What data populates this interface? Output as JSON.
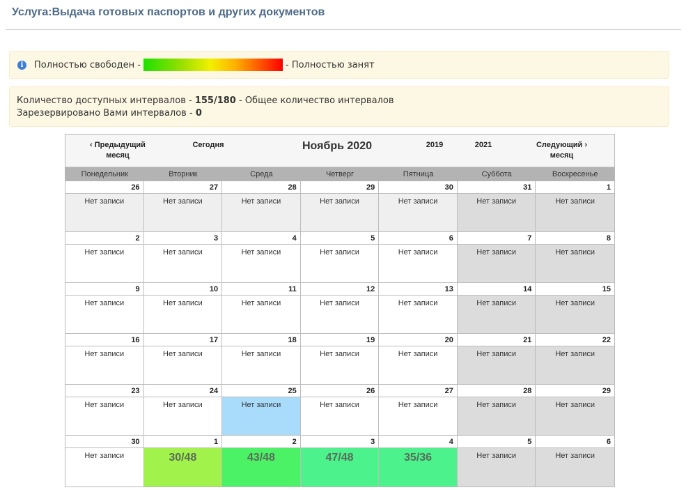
{
  "title": "Услуга:Выдача готовых паспортов и других документов",
  "legend": {
    "free_label": "Полностью свободен -",
    "busy_label": "- Полностью занят",
    "info_icon": "info-icon"
  },
  "stats": {
    "line1_prefix": "Количество доступных интервалов -",
    "line1_value": "155/180",
    "line1_suffix": "- Общее количество интервалов",
    "line2_prefix": "Зарезервировано Вами интервалов -",
    "line2_value": "0"
  },
  "calendar": {
    "prev_month": "‹ Предыдущий месяц",
    "today": "Сегодня",
    "month_title": "Ноябрь 2020",
    "prev_year": "2019",
    "next_year": "2021",
    "next_month": "Следующий › месяц",
    "weekdays": [
      "Понедельник",
      "Вторник",
      "Среда",
      "Четверг",
      "Пятница",
      "Суббота",
      "Воскресенье"
    ],
    "weeks": [
      [
        {
          "day": "26",
          "text": "Нет записи",
          "kind": "other"
        },
        {
          "day": "27",
          "text": "Нет записи",
          "kind": "other"
        },
        {
          "day": "28",
          "text": "Нет записи",
          "kind": "other"
        },
        {
          "day": "29",
          "text": "Нет записи",
          "kind": "other"
        },
        {
          "day": "30",
          "text": "Нет записи",
          "kind": "other"
        },
        {
          "day": "31",
          "text": "Нет записи",
          "kind": "weekend"
        },
        {
          "day": "1",
          "text": "Нет записи",
          "kind": "weekend"
        }
      ],
      [
        {
          "day": "2",
          "text": "Нет записи",
          "kind": "normal"
        },
        {
          "day": "3",
          "text": "Нет записи",
          "kind": "normal"
        },
        {
          "day": "4",
          "text": "Нет записи",
          "kind": "normal"
        },
        {
          "day": "5",
          "text": "Нет записи",
          "kind": "normal"
        },
        {
          "day": "6",
          "text": "Нет записи",
          "kind": "normal"
        },
        {
          "day": "7",
          "text": "Нет записи",
          "kind": "weekend"
        },
        {
          "day": "8",
          "text": "Нет записи",
          "kind": "weekend"
        }
      ],
      [
        {
          "day": "9",
          "text": "Нет записи",
          "kind": "normal"
        },
        {
          "day": "10",
          "text": "Нет записи",
          "kind": "normal"
        },
        {
          "day": "11",
          "text": "Нет записи",
          "kind": "normal"
        },
        {
          "day": "12",
          "text": "Нет записи",
          "kind": "normal"
        },
        {
          "day": "13",
          "text": "Нет записи",
          "kind": "normal"
        },
        {
          "day": "14",
          "text": "Нет записи",
          "kind": "weekend"
        },
        {
          "day": "15",
          "text": "Нет записи",
          "kind": "weekend"
        }
      ],
      [
        {
          "day": "16",
          "text": "Нет записи",
          "kind": "normal"
        },
        {
          "day": "17",
          "text": "Нет записи",
          "kind": "normal"
        },
        {
          "day": "18",
          "text": "Нет записи",
          "kind": "normal"
        },
        {
          "day": "19",
          "text": "Нет записи",
          "kind": "normal"
        },
        {
          "day": "20",
          "text": "Нет записи",
          "kind": "normal"
        },
        {
          "day": "21",
          "text": "Нет записи",
          "kind": "weekend"
        },
        {
          "day": "22",
          "text": "Нет записи",
          "kind": "weekend"
        }
      ],
      [
        {
          "day": "23",
          "text": "Нет записи",
          "kind": "normal"
        },
        {
          "day": "24",
          "text": "Нет записи",
          "kind": "normal"
        },
        {
          "day": "25",
          "text": "Нет записи",
          "kind": "today"
        },
        {
          "day": "26",
          "text": "Нет записи",
          "kind": "normal"
        },
        {
          "day": "27",
          "text": "Нет записи",
          "kind": "normal"
        },
        {
          "day": "28",
          "text": "Нет записи",
          "kind": "weekend"
        },
        {
          "day": "29",
          "text": "Нет записи",
          "kind": "weekend"
        }
      ],
      [
        {
          "day": "30",
          "text": "Нет записи",
          "kind": "normal"
        },
        {
          "day": "1",
          "text": "30/48",
          "kind": "slots",
          "color": "#a2f24c"
        },
        {
          "day": "2",
          "text": "43/48",
          "kind": "slots",
          "color": "#4cf266"
        },
        {
          "day": "3",
          "text": "47/48",
          "kind": "slots",
          "color": "#4cf28c"
        },
        {
          "day": "4",
          "text": "35/36",
          "kind": "slots",
          "color": "#4cf28c"
        },
        {
          "day": "5",
          "text": "Нет записи",
          "kind": "weekend"
        },
        {
          "day": "6",
          "text": "Нет записи",
          "kind": "weekend"
        }
      ]
    ]
  },
  "colors": {
    "title": "#4d6a87",
    "alert_bg": "#fcf8e3",
    "weekend_bg": "#dcdcdc",
    "today_bg": "#a9dcfb"
  }
}
